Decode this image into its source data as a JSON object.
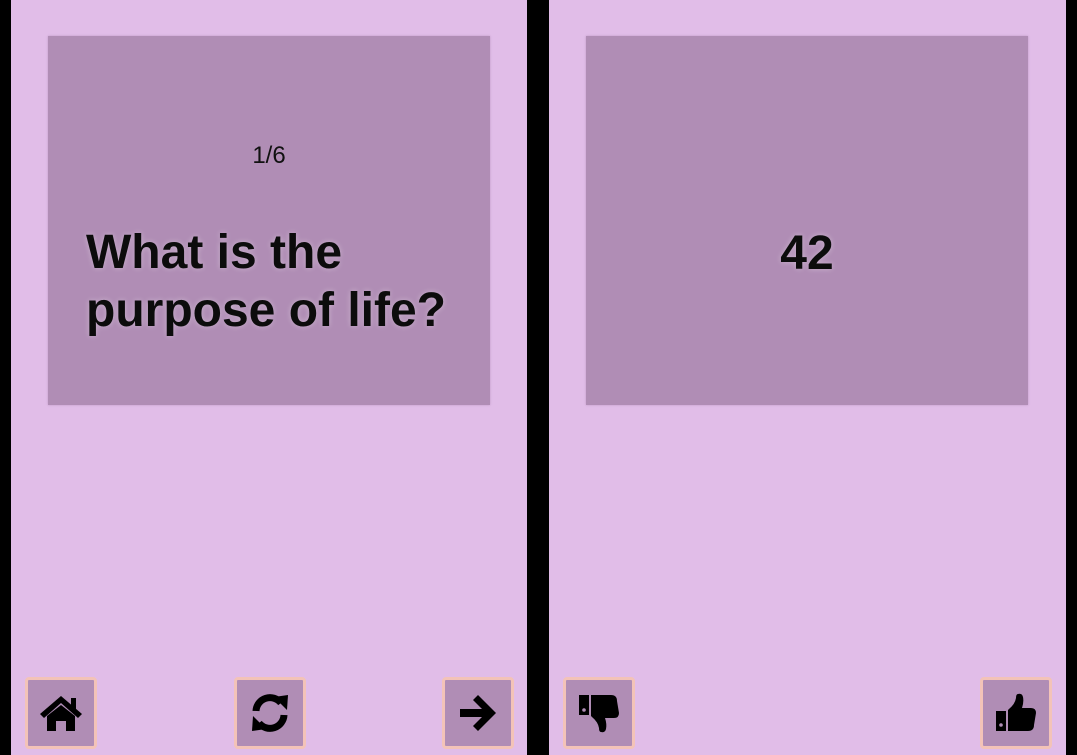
{
  "left_panel": {
    "counter": "1/6",
    "question": "What is the purpose of life?",
    "buttons": [
      {
        "icon": "home-icon"
      },
      {
        "icon": "refresh-icon"
      },
      {
        "icon": "arrow-right-icon"
      }
    ]
  },
  "right_panel": {
    "answer": "42",
    "buttons": [
      {
        "icon": "thumbs-down-icon"
      },
      {
        "icon": "thumbs-up-icon"
      }
    ]
  },
  "colors": {
    "background": "#e1bde8",
    "card": "#b08db5",
    "button_border": "#f3c3b8",
    "separator": "#000000",
    "text": "#0c0c0c"
  }
}
